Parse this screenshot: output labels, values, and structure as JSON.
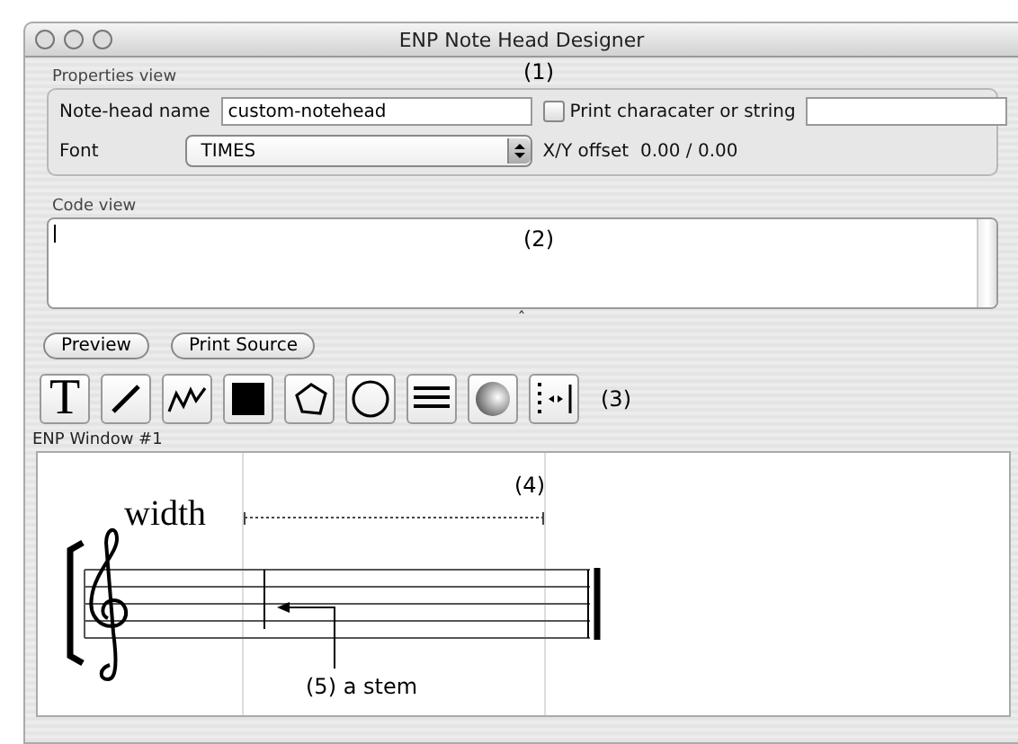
{
  "window": {
    "title": "ENP Note Head Designer"
  },
  "properties_view": {
    "title": "Properties view",
    "annotation": "(1)",
    "name_label": "Note-head name",
    "name_value": "custom-notehead",
    "print_label": "Print characater or string",
    "print_checked": false,
    "font_label": "Font",
    "font_value": "TIMES",
    "offset_label": "X/Y offset",
    "offset_value": "0.00 / 0.00"
  },
  "code_view": {
    "title": "Code view",
    "annotation": "(2)"
  },
  "splitter": "ˆ",
  "buttons": [
    "Preview",
    "Print Source"
  ],
  "tools": [
    {
      "kind": "text",
      "label": "T"
    },
    {
      "kind": "line"
    },
    {
      "kind": "polyline"
    },
    {
      "kind": "rect"
    },
    {
      "kind": "polygon"
    },
    {
      "kind": "circle"
    },
    {
      "kind": "lines"
    },
    {
      "kind": "sphere"
    },
    {
      "kind": "spacing"
    }
  ],
  "tools_annotation": "(3)",
  "enp_window": {
    "title": "ENP Window #1",
    "width_label": "width",
    "annotation": "(4)",
    "stem_annotation": "(5) a stem"
  }
}
